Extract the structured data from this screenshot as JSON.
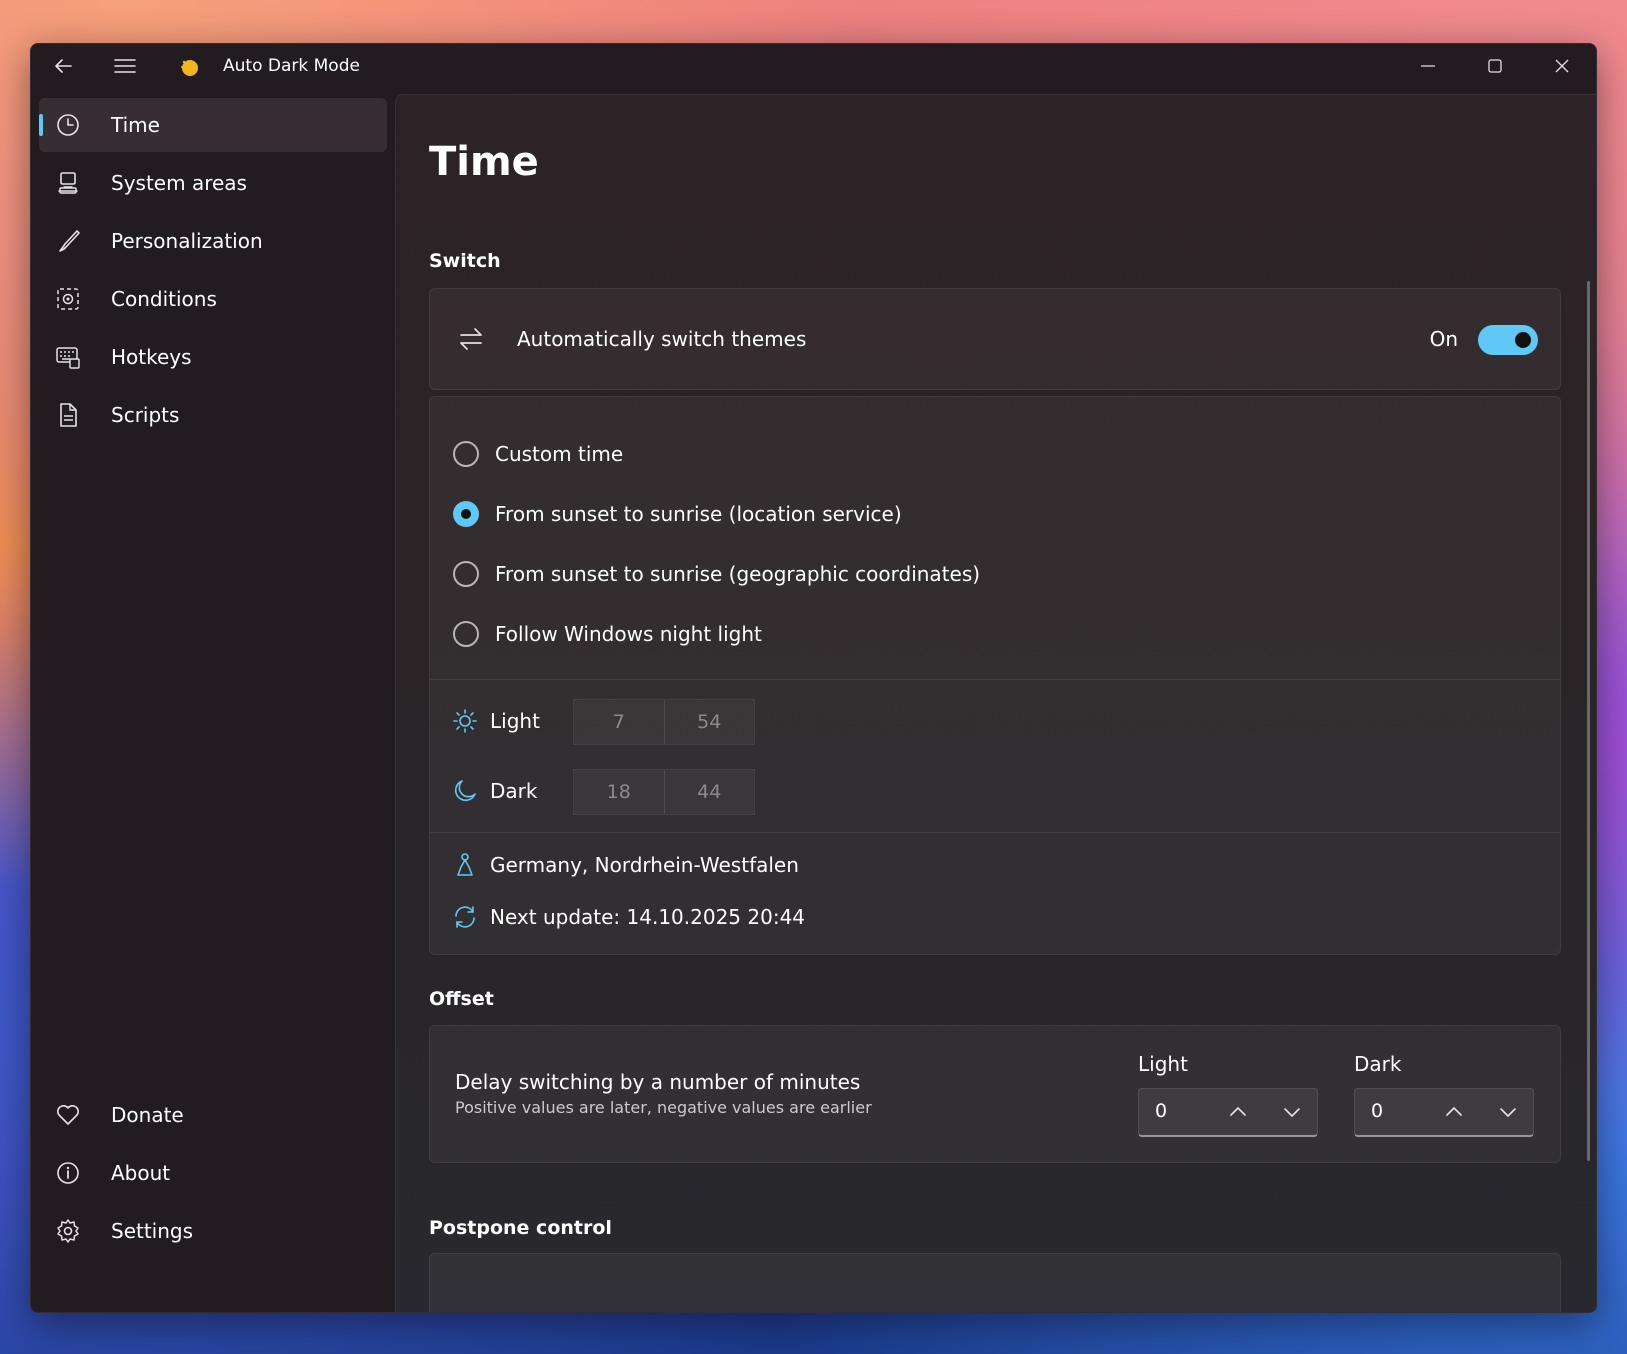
{
  "window": {
    "title": "Auto Dark Mode"
  },
  "sidebar": {
    "items": [
      {
        "label": "Time",
        "icon": "clock-icon",
        "active": true
      },
      {
        "label": "System areas",
        "icon": "computer-icon"
      },
      {
        "label": "Personalization",
        "icon": "brush-icon"
      },
      {
        "label": "Conditions",
        "icon": "conditions-icon"
      },
      {
        "label": "Hotkeys",
        "icon": "keyboard-icon"
      },
      {
        "label": "Scripts",
        "icon": "document-icon"
      }
    ],
    "footer": [
      {
        "label": "Donate",
        "icon": "heart-icon"
      },
      {
        "label": "About",
        "icon": "info-icon"
      },
      {
        "label": "Settings",
        "icon": "gear-icon"
      }
    ]
  },
  "page": {
    "title": "Time",
    "switch_section": "Switch",
    "auto_switch": {
      "label": "Automatically switch themes",
      "state_label": "On",
      "enabled": true
    },
    "modes": [
      {
        "label": "Custom time",
        "selected": false
      },
      {
        "label": "From sunset to sunrise (location service)",
        "selected": true
      },
      {
        "label": "From sunset to sunrise (geographic coordinates)",
        "selected": false
      },
      {
        "label": "Follow Windows night light",
        "selected": false
      }
    ],
    "light": {
      "label": "Light",
      "hour": "7",
      "minute": "54"
    },
    "dark": {
      "label": "Dark",
      "hour": "18",
      "minute": "44"
    },
    "location": "Germany, Nordrhein-Westfalen",
    "next_update": "Next update: 14.10.2025 20:44",
    "offset_section": "Offset",
    "offset": {
      "title": "Delay switching by a number of minutes",
      "subtitle": "Positive values are later, negative values are earlier",
      "light_label": "Light",
      "light_value": "0",
      "dark_label": "Dark",
      "dark_value": "0"
    },
    "postpone_section": "Postpone control"
  },
  "colors": {
    "accent": "#5fc8f5",
    "window_bg": "#221c21",
    "content_bg": "#2b2326"
  }
}
